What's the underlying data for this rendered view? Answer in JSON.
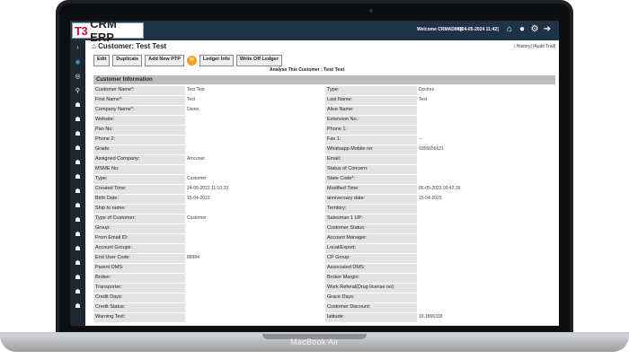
{
  "device": {
    "model": "MacBook Air"
  },
  "header": {
    "logo_t3": "T3",
    "logo_name": "CRM ERP",
    "welcome": "Welcome CRMADMIN",
    "datetime": "[04-05-2024 11:42]"
  },
  "page": {
    "title": "Customer: Test Test",
    "links": "| History| |Audit Trail|",
    "analyse_label": "Analyse This Customer :",
    "analyse_value": "Test Test",
    "section": "Customer Information"
  },
  "toolbar": {
    "edit": "Edit",
    "duplicate": "Duplicate",
    "add_ptp": "Add New PTP",
    "ledger_info": "Ledger Info",
    "write_off": "Write Off Ledger"
  },
  "rows": [
    [
      "Customer Name*:",
      "Test Test",
      "Type:",
      "Doctors"
    ],
    [
      "First Name*:",
      "Test",
      "Last Name:",
      "Test"
    ],
    [
      "Company Name*:",
      "Demo",
      "Alise Name:",
      ""
    ],
    [
      "Website:",
      "",
      "Extension No.:",
      ""
    ],
    [
      "Pan No:",
      "",
      "Phone 1:",
      ""
    ],
    [
      "Phone 2:",
      "",
      "Fax 1:",
      "--"
    ],
    [
      "Grade:",
      "",
      "Whatsapp Mobile no:",
      "9356656621"
    ],
    [
      "Assigned Company:",
      "Amconet",
      "Email:",
      ""
    ],
    [
      "MSME No:",
      "",
      "Status of Concern:",
      ""
    ],
    [
      "Type:",
      "Customer",
      "State Code*:",
      ""
    ],
    [
      "Created Time:",
      "24-08-2022 11:10:23",
      "Modified Time:",
      "05-05-2023 09:42:36"
    ],
    [
      "Birth Date:",
      "15-04-2023",
      "anniversary date:",
      "15-04-2023"
    ],
    [
      "Ship to name:",
      "",
      "Territory:",
      ""
    ],
    [
      "Type of Customer:",
      "Customer",
      "Salesman 1 UP:",
      ""
    ],
    [
      "Group:",
      "",
      "Customer Status:",
      ""
    ],
    [
      "From Email ID:",
      "",
      "Account Manager:",
      ""
    ],
    [
      "Account Groups:",
      "",
      "Local/Export:",
      ""
    ],
    [
      "End User Code:",
      "88984",
      "CP Group:",
      ""
    ],
    [
      "Parent DMS:",
      "",
      "Associated DMS:",
      ""
    ],
    [
      "Broker:",
      "",
      "Broker Margin:",
      ""
    ],
    [
      "Transporter:",
      "",
      "Work Referal(Drug license no):",
      ""
    ],
    [
      "Credit Days:",
      "",
      "Grace Days:",
      ""
    ],
    [
      "Credit Status:",
      "",
      "Customer Discount:",
      ""
    ],
    [
      "Warning Text:",
      "",
      "latitude:",
      "19.1856338"
    ]
  ]
}
